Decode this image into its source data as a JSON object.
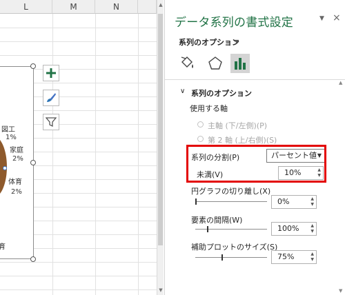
{
  "sheet": {
    "columns": [
      "L",
      "M",
      "N"
    ],
    "chart_labels": [
      {
        "name": "図工",
        "value": "1%"
      },
      {
        "name": "家庭",
        "value": "2%"
      },
      {
        "name": "体育",
        "value": "2%"
      }
    ],
    "chart_partial_label": "育"
  },
  "pane": {
    "title": "データ系列の書式設定",
    "close_glyph": "×",
    "dropdown_glyph": "▼",
    "options_menu": "系列のオプション",
    "options_menu_caret": "▼",
    "tabs": [
      {
        "icon": "fill-line-icon"
      },
      {
        "icon": "effects-icon"
      },
      {
        "icon": "series-options-icon",
        "active": true
      }
    ],
    "section_chevron": "∨",
    "section_title": "系列のオプション",
    "axis_label": "使用する軸",
    "primary_axis": "主軸 (下/左側)(P)",
    "secondary_axis": "第 2 軸 (上/右側)(S)",
    "split_label": "系列の分割(P)",
    "split_value": "パーセント値",
    "less_than_label": "未満(V)",
    "less_than_value": "10%",
    "explosion_label": "円グラフの切り離し(X)",
    "explosion_value": "0%",
    "gap_label": "要素の間隔(W)",
    "gap_value": "100%",
    "second_plot_label": "補助プロットのサイズ(S)",
    "second_plot_value": "75%",
    "accent_color": "#217346",
    "highlight_color": "#e30000"
  }
}
